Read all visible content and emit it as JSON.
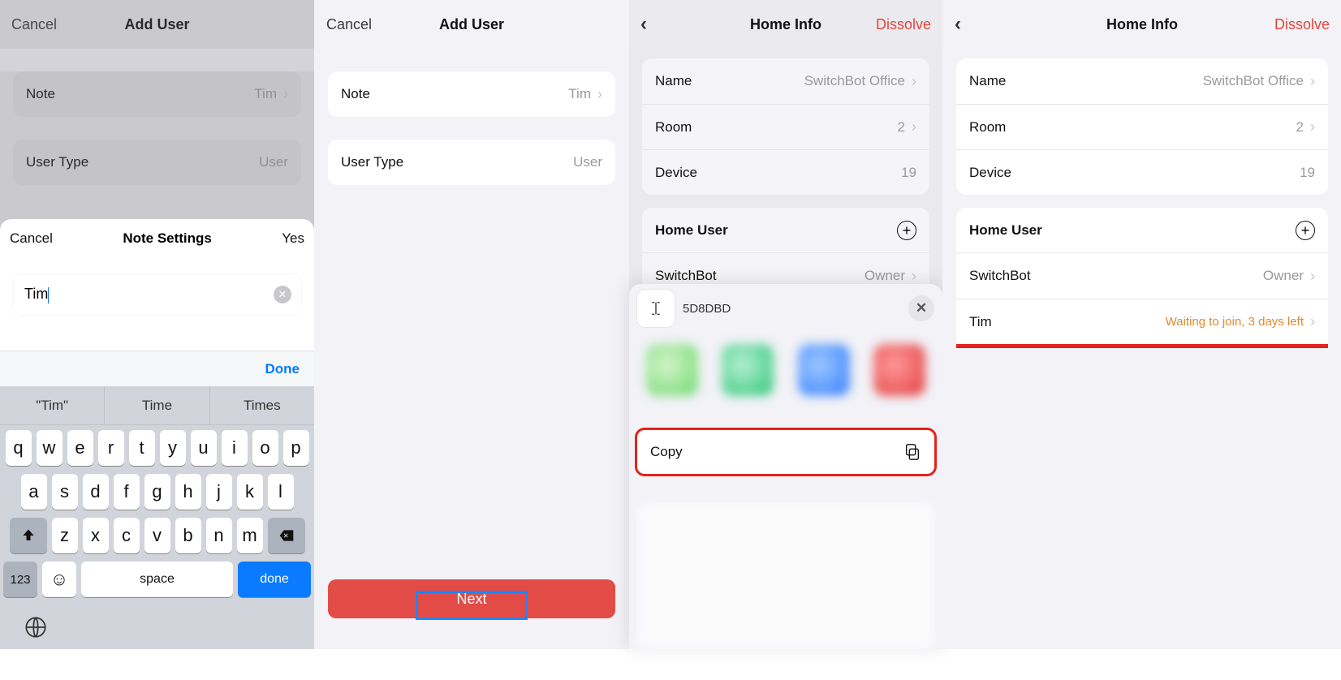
{
  "panelA": {
    "nav": {
      "cancel": "Cancel",
      "title": "Add User"
    },
    "rows": {
      "note_label": "Note",
      "note_value": "Tim",
      "usertype_label": "User Type",
      "usertype_value": "User"
    },
    "sheet": {
      "cancel": "Cancel",
      "title": "Note Settings",
      "yes": "Yes",
      "input_value": "Tim"
    },
    "keyboard": {
      "done": "Done",
      "suggestions": [
        "\"Tim\"",
        "Time",
        "Times"
      ],
      "row1": [
        "q",
        "w",
        "e",
        "r",
        "t",
        "y",
        "u",
        "i",
        "o",
        "p"
      ],
      "row2": [
        "a",
        "s",
        "d",
        "f",
        "g",
        "h",
        "j",
        "k",
        "l"
      ],
      "row3": [
        "z",
        "x",
        "c",
        "v",
        "b",
        "n",
        "m"
      ],
      "num": "123",
      "space": "space",
      "done_key": "done"
    }
  },
  "panelB": {
    "nav": {
      "cancel": "Cancel",
      "title": "Add User"
    },
    "rows": {
      "note_label": "Note",
      "note_value": "Tim",
      "usertype_label": "User Type",
      "usertype_value": "User"
    },
    "next": "Next"
  },
  "panelC": {
    "nav": {
      "title": "Home Info",
      "dissolve": "Dissolve"
    },
    "rows": {
      "name_label": "Name",
      "name_value": "SwitchBot Office",
      "room_label": "Room",
      "room_value": "2",
      "device_label": "Device",
      "device_value": "19"
    },
    "homeuser_header": "Home User",
    "users": [
      {
        "name": "SwitchBot",
        "role": "Owner"
      }
    ],
    "share": {
      "code": "5D8DBD",
      "copy": "Copy"
    }
  },
  "panelD": {
    "nav": {
      "title": "Home Info",
      "dissolve": "Dissolve"
    },
    "rows": {
      "name_label": "Name",
      "name_value": "SwitchBot Office",
      "room_label": "Room",
      "room_value": "2",
      "device_label": "Device",
      "device_value": "19"
    },
    "homeuser_header": "Home User",
    "users": [
      {
        "name": "SwitchBot",
        "role": "Owner"
      },
      {
        "name": "Tim",
        "status": "Waiting to join, 3 days left"
      }
    ]
  }
}
